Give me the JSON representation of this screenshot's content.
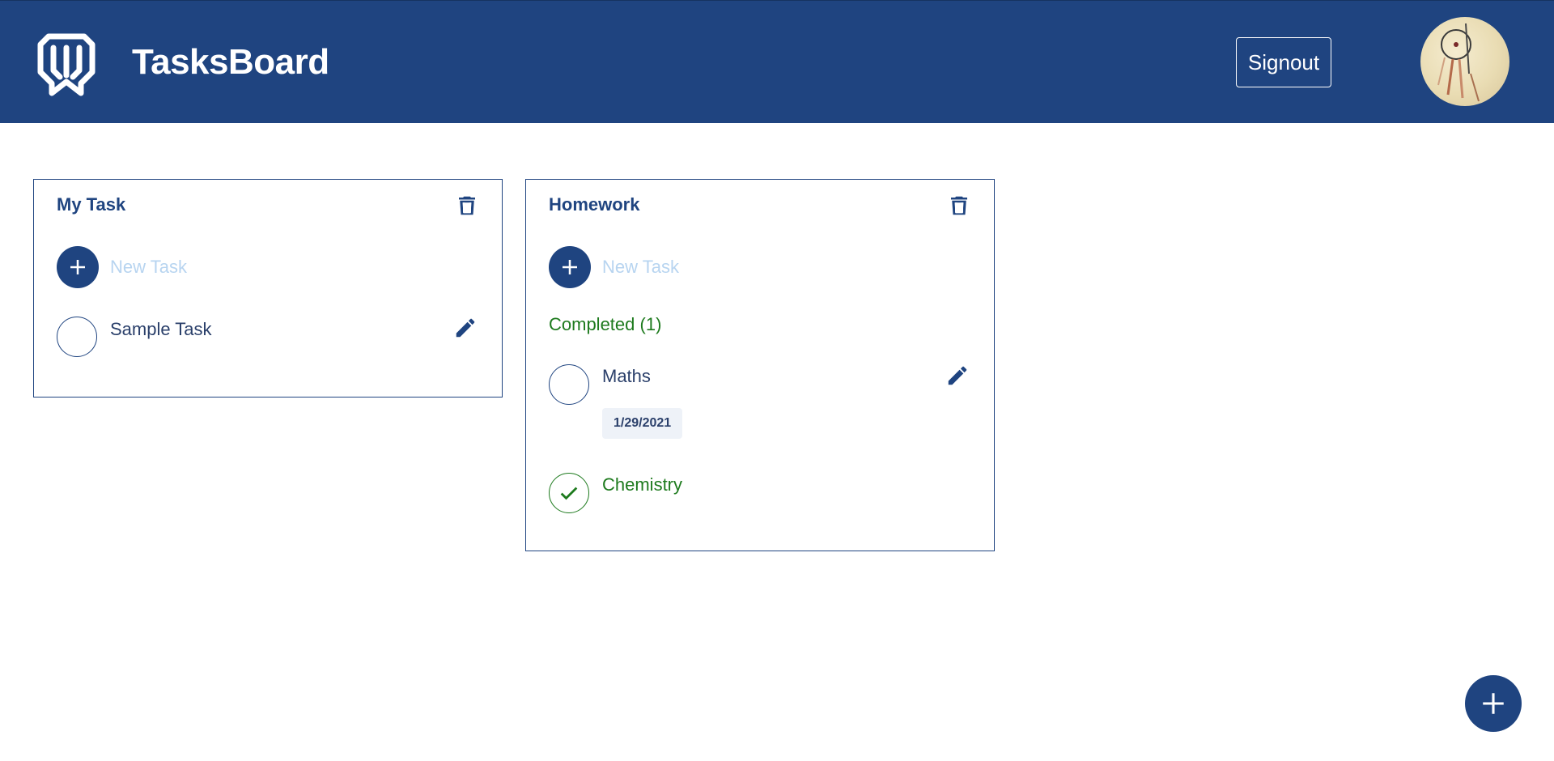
{
  "header": {
    "title": "TasksBoard",
    "signout_label": "Signout",
    "logo_icon": "tasksboard-logo-icon",
    "avatar_icon": "user-avatar"
  },
  "colors": {
    "primary": "#1f4480",
    "completed": "#1d7a1d",
    "placeholder": "#b7d4f0",
    "chip_bg": "#eef2f8"
  },
  "lists": [
    {
      "title": "My Task",
      "new_task_placeholder": "New Task",
      "tasks": [
        {
          "label": "Sample Task",
          "completed": false
        }
      ]
    },
    {
      "title": "Homework",
      "new_task_placeholder": "New Task",
      "completed_section": "Completed (1)",
      "tasks": [
        {
          "label": "Maths",
          "due": "1/29/2021",
          "completed": false
        },
        {
          "label": "Chemistry",
          "completed": true
        }
      ]
    }
  ],
  "fab": {
    "icon": "plus-icon"
  }
}
